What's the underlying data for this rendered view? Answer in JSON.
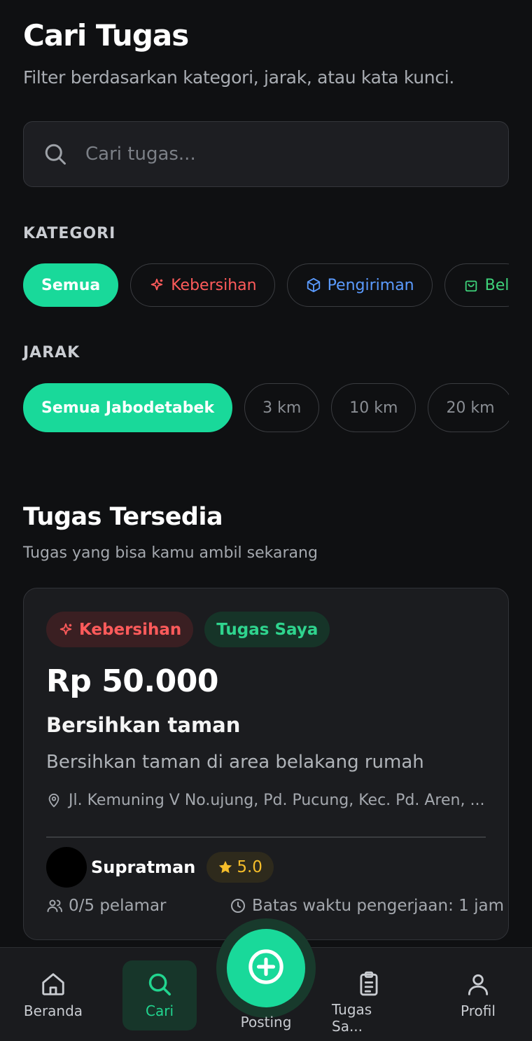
{
  "header": {
    "title": "Cari Tugas",
    "subtitle": "Filter berdasarkan kategori, jarak, atau kata kunci."
  },
  "search": {
    "placeholder": "Cari tugas...",
    "icon": "search-icon"
  },
  "categories": {
    "label": "KATEGORI",
    "items": [
      {
        "label": "Semua",
        "active": true
      },
      {
        "label": "Kebersihan",
        "icon": "sparkle-icon",
        "color": "#ff5b5b"
      },
      {
        "label": "Pengiriman",
        "icon": "box-icon",
        "color": "#5b9bff"
      },
      {
        "label": "Bel",
        "icon": "shopping-bag-icon",
        "color": "#3ed27a"
      }
    ]
  },
  "distance": {
    "label": "JARAK",
    "items": [
      {
        "label": "Semua Jabodetabek",
        "active": true
      },
      {
        "label": "3 km"
      },
      {
        "label": "10 km"
      },
      {
        "label": "20 km"
      }
    ]
  },
  "list": {
    "title": "Tugas Tersedia",
    "subtitle": "Tugas yang bisa kamu ambil sekarang"
  },
  "task_card": {
    "category_tag": "Kebersihan",
    "owner_tag": "Tugas Saya",
    "price": "Rp 50.000",
    "title": "Bersihkan taman",
    "description": "Bersihkan taman di area belakang rumah",
    "location": "Jl. Kemuning V No.ujung, Pd. Pucung, Kec. Pd. Aren, ...",
    "poster_name": "Supratman",
    "rating": "5.0",
    "applicants": "0/5 pelamar",
    "deadline": "Batas waktu pengerjaan: 1 jam"
  },
  "bottom_nav": {
    "items": [
      {
        "label": "Beranda",
        "icon": "home-icon"
      },
      {
        "label": "Cari",
        "icon": "search-icon",
        "active": true
      },
      {
        "label": "Posting",
        "icon": "plus-circle-icon"
      },
      {
        "label": "Tugas Sa...",
        "icon": "clipboard-icon"
      },
      {
        "label": "Profil",
        "icon": "user-icon"
      }
    ]
  },
  "colors": {
    "accent": "#19d99a",
    "background": "#0f1012",
    "card": "#1b1c1f",
    "danger": "#ff5b5b",
    "info": "#5b9bff",
    "rating": "#f5bd2a"
  }
}
